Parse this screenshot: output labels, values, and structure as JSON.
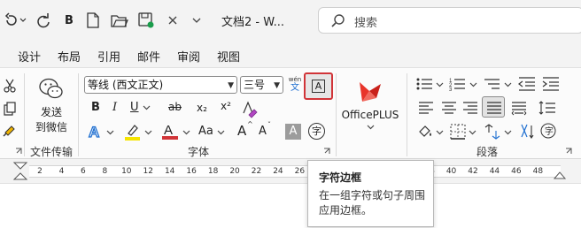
{
  "titlebar": {
    "bold_label": "B",
    "doc_title": "文档2 - W...",
    "search_placeholder": "搜索"
  },
  "tabs": [
    "设计",
    "布局",
    "引用",
    "邮件",
    "审阅",
    "视图"
  ],
  "ribbon": {
    "wechat": {
      "label_line1": "发送",
      "label_line2": "到微信",
      "group": "文件传输"
    },
    "font": {
      "font_name": "等线 (西文正文)",
      "font_size": "三号",
      "bold": "B",
      "italic": "I",
      "underline": "U",
      "strike": "ab",
      "subscript": "x₂",
      "superscript": "x²",
      "grow": "A",
      "shrink": "A",
      "case": "Aa",
      "shade": "A",
      "encircle": "字",
      "phonetic_top": "wén",
      "phonetic_bottom": "文",
      "border_char": "A",
      "group": "字体",
      "accent_red": "#d13438",
      "accent_yellow": "#f5e400",
      "accent_blue": "#1f6fd0"
    },
    "officeplus": {
      "label": "OfficePLUS"
    },
    "paragraph": {
      "group": "段落"
    }
  },
  "ruler": {
    "numbers": [
      "2",
      "4",
      "6",
      "8",
      "10",
      "12",
      "14",
      "16",
      "18",
      "20",
      "22",
      "24",
      "26",
      "28",
      "30",
      "32",
      "34",
      "36",
      "38",
      "40",
      "42",
      "44",
      "46",
      "48"
    ]
  },
  "tooltip": {
    "title": "字符边框",
    "description": "在一组字符或句子周围应用边框。"
  }
}
